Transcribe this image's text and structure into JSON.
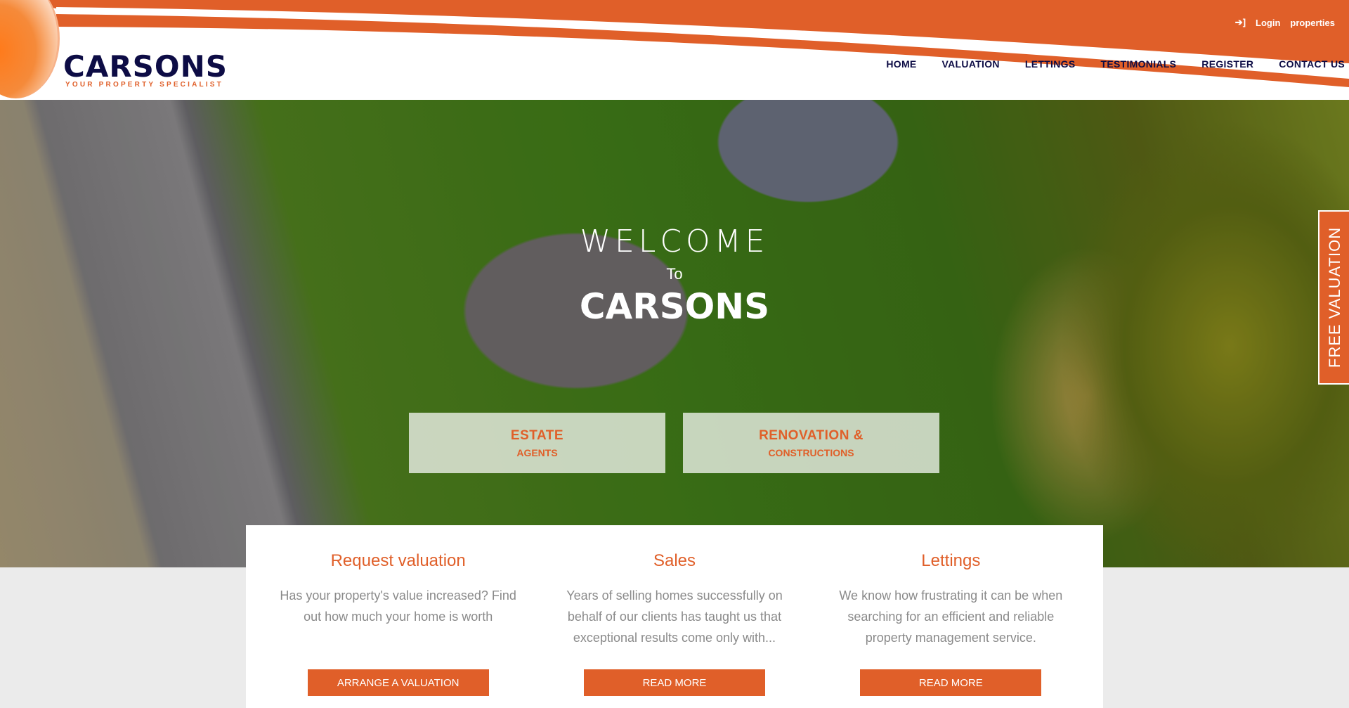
{
  "brand": {
    "name": "CARSONS",
    "tagline": "YOUR PROPERTY SPECIALIST",
    "accent": "#e05f29",
    "navy": "#0d0c45"
  },
  "toplinks": {
    "login_icon": "sign-in-icon",
    "login": "Login",
    "properties": "properties"
  },
  "nav": [
    "HOME",
    "VALUATION",
    "LETTINGS",
    "TESTIMONIALS",
    "REGISTER",
    "CONTACT US"
  ],
  "hero": {
    "welcome": "WELCOME",
    "to": "To",
    "brand": "CARSONS",
    "buttons": [
      {
        "line1": "ESTATE",
        "line2": "AGENTS"
      },
      {
        "line1": "RENOVATION &",
        "line2": "CONSTRUCTIONS"
      }
    ]
  },
  "side_tab": "FREE VALUATION",
  "cards": [
    {
      "title": "Request valuation",
      "text": "Has your property's value increased? Find out how much your home is worth",
      "button": "ARRANGE A VALUATION"
    },
    {
      "title": "Sales",
      "text": "Years of selling homes successfully on behalf of our clients has taught us that exceptional results come only with...",
      "button": "READ MORE"
    },
    {
      "title": "Lettings",
      "text": "We know how frustrating it can be when searching for an efficient and reliable property management service.",
      "button": "READ MORE"
    }
  ]
}
